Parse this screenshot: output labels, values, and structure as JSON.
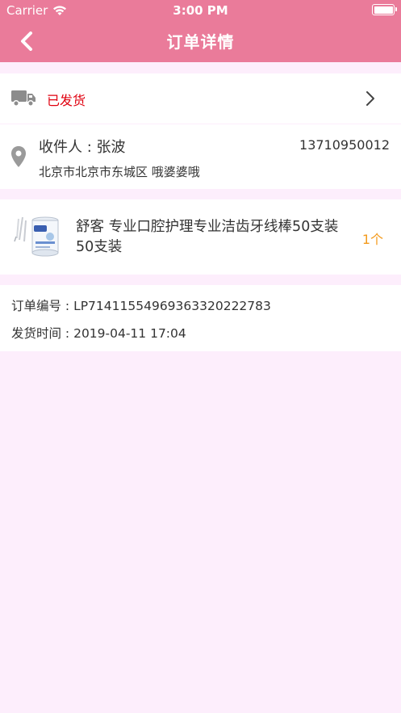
{
  "status_bar": {
    "carrier": "Carrier",
    "time": "3:00 PM"
  },
  "nav": {
    "title": "订单详情",
    "back_icon": "chevron-left-icon"
  },
  "shipping": {
    "status": "已发货",
    "icon": "truck-icon"
  },
  "address": {
    "recipient": "收件人 : 张波",
    "phone": "13710950012",
    "detail": "北京市北京市东城区 哦婆婆哦",
    "icon": "location-pin-icon"
  },
  "product": {
    "name": "舒客 专业口腔护理专业洁齿牙线棒50支装 50支装",
    "quantity": "1个"
  },
  "order_info": {
    "order_no": "订单编号 : LP7141155496936332022278​3",
    "ship_time": "发货时间 : 2019-04-11 17:04"
  },
  "colors": {
    "header": "#ea7b9a",
    "background": "#fdeefc",
    "status_red": "#e0000f",
    "qty_orange": "#f39a1c"
  }
}
